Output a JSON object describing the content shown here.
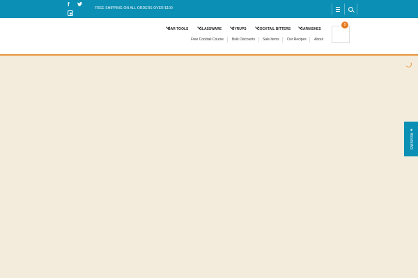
{
  "topbar": {
    "promo": "FREE SHIPPING ON ALL ORDERS OVER $100",
    "social_icons": [
      "facebook-icon",
      "twitter-icon",
      "instagram-icon"
    ],
    "bg_color": "#0b8fb4"
  },
  "mainnav": [
    {
      "label": "BAR TOOLS"
    },
    {
      "label": "GLASSWARE"
    },
    {
      "label": "SYRUPS"
    },
    {
      "label": "COCKTAIL BITTERS"
    },
    {
      "label": "GARNISHES"
    }
  ],
  "subnav": [
    {
      "label": "Free Cocktail Course"
    },
    {
      "label": "Bulk Discounts"
    },
    {
      "label": "Sale Items"
    },
    {
      "label": "Our Recipes"
    },
    {
      "label": "About"
    }
  ],
  "cart": {
    "count": "0"
  },
  "reviews": {
    "label": "★ REVIEWS"
  },
  "colors": {
    "accent": "#e8943a",
    "badge": "#e57b22",
    "page_bg": "#f3ecdc"
  }
}
